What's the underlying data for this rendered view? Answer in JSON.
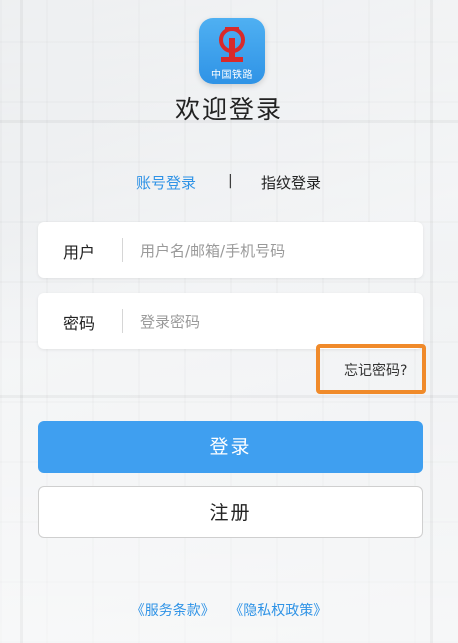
{
  "app": {
    "logo_text": "中国铁路",
    "title": "欢迎登录"
  },
  "tabs": {
    "account": "账号登录",
    "separator": "|",
    "fingerprint": "指纹登录"
  },
  "form": {
    "user_label": "用户",
    "user_placeholder": "用户名/邮箱/手机号码",
    "pass_label": "密码",
    "pass_placeholder": "登录密码",
    "forgot": "忘记密码?"
  },
  "buttons": {
    "login": "登录",
    "register": "注册"
  },
  "links": {
    "terms": "《服务条款》",
    "privacy": "《隐私权政策》"
  },
  "colors": {
    "accent": "#2f93e6",
    "login_button": "#3f9ff0",
    "highlight": "#f08a2a"
  }
}
